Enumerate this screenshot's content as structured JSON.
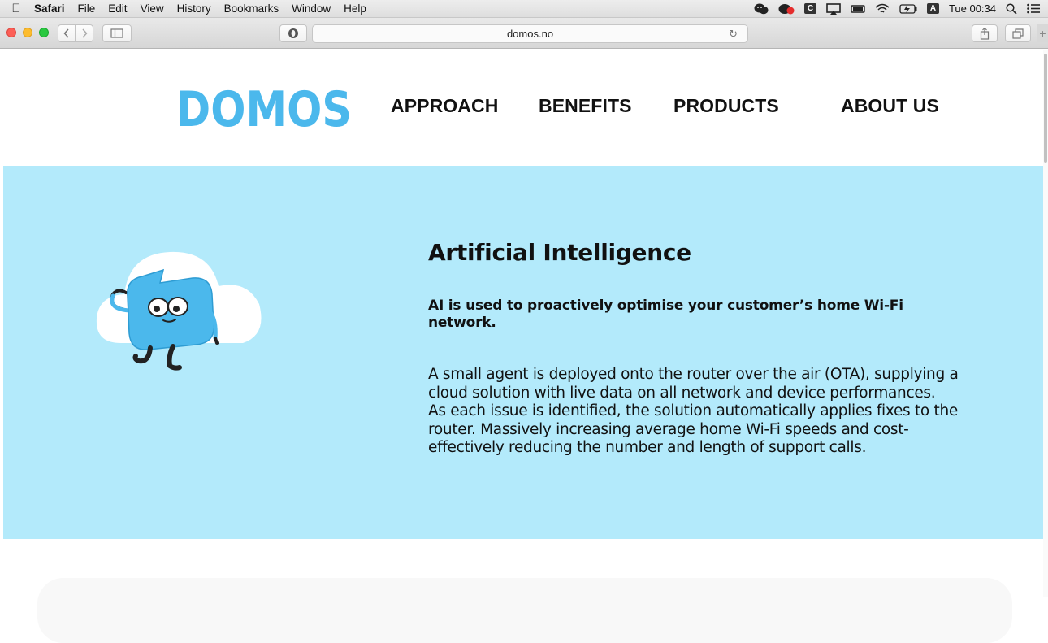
{
  "menubar": {
    "app_name": "Safari",
    "menus": [
      "File",
      "Edit",
      "View",
      "History",
      "Bookmarks",
      "Window",
      "Help"
    ],
    "clock": "Tue 00:34",
    "input_badge": "A"
  },
  "browser": {
    "url": "domos.no"
  },
  "site": {
    "logo_text": "DOMOS",
    "nav": [
      "APPROACH",
      "BENEFITS",
      "PRODUCTS",
      "ABOUT US"
    ],
    "active_nav": "PRODUCTS",
    "brand_color": "#4bb8ec",
    "hero_bg": "#b3eafb"
  },
  "hero": {
    "title": "Artificial Intelligence",
    "lead": "AI is used to proactively optimise your customer’s home Wi-Fi network.",
    "body_p1": "A small agent is deployed onto the router over the air (OTA), supplying a cloud solution with live data on all network and device performances.",
    "body_p2": "As each issue is identified, the solution automatically applies fixes to the router. Massively increasing average home Wi-Fi speeds and cost-effectively reducing the number and length of support calls."
  }
}
